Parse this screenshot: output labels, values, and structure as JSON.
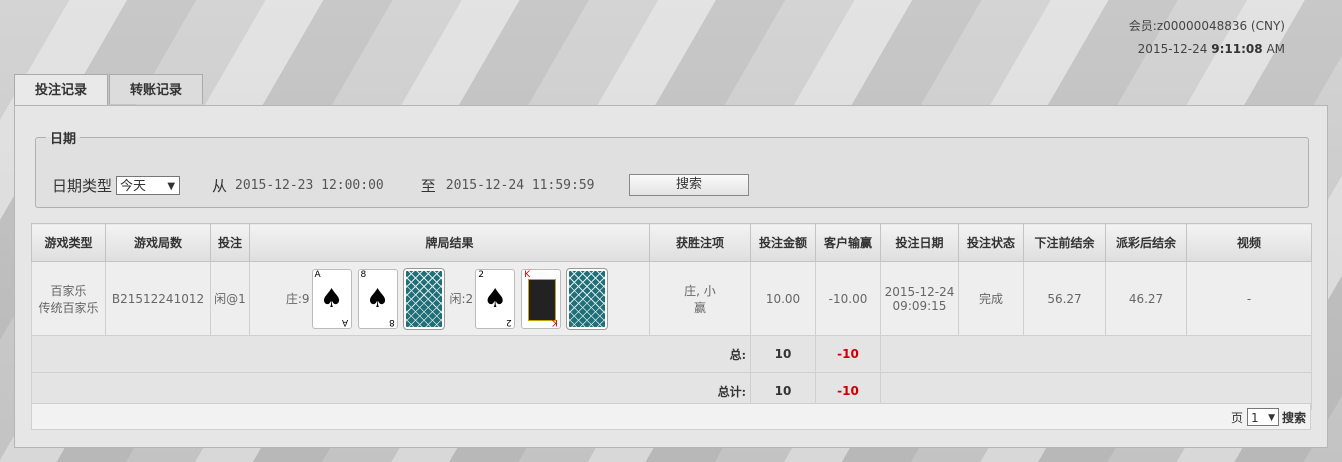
{
  "header": {
    "member": "会员:z00000048836 (CNY)",
    "date": "2015-12-24",
    "time": "9:11:08",
    "ampm": "AM"
  },
  "tabs": [
    {
      "label": "投注记录",
      "active": true
    },
    {
      "label": "转账记录",
      "active": false
    }
  ],
  "filter": {
    "legend": "日期",
    "date_type_label": "日期类型",
    "date_type_value": "今天",
    "from_label": "从",
    "from_value": "2015-12-23 12:00:00",
    "to_label": "至",
    "to_value": "2015-12-24 11:59:59",
    "search_label": "搜索"
  },
  "columns": [
    "游戏类型",
    "游戏局数",
    "投注",
    "牌局结果",
    "获胜注项",
    "投注金额",
    "客户输赢",
    "投注日期",
    "投注状态",
    "下注前结余",
    "派彩后结余",
    "视频"
  ],
  "row": {
    "game_type_1": "百家乐",
    "game_type_2": "传统百家乐",
    "round": "B21512241012",
    "bet": "闲@1",
    "banker_label": "庄:9",
    "player_label": "闲:2",
    "banker_cards": [
      {
        "rank": "A",
        "suit": "♠",
        "pip": "♠"
      },
      {
        "rank": "8",
        "suit": "♠",
        "pip": "♠"
      },
      {
        "back": true
      }
    ],
    "player_cards": [
      {
        "rank": "2",
        "suit": "♠",
        "pip": "♠"
      },
      {
        "rank": "K",
        "suit": "♥",
        "king": true
      },
      {
        "back": true
      }
    ],
    "winning_1": "庄, 小",
    "winning_2": "赢",
    "amount": "10.00",
    "win_loss": "-10.00",
    "bet_date_1": "2015-12-24",
    "bet_date_2": "09:09:15",
    "status": "完成",
    "balance_before": "56.27",
    "balance_after": "46.27",
    "video": "-"
  },
  "totals": {
    "subtotal_label": "总:",
    "subtotal_amount": "10",
    "subtotal_winloss": "-10",
    "grand_label": "总计:",
    "grand_amount": "10",
    "grand_winloss": "-10"
  },
  "pager": {
    "page_label": "页",
    "page_value": "1",
    "search_label": "搜索"
  }
}
